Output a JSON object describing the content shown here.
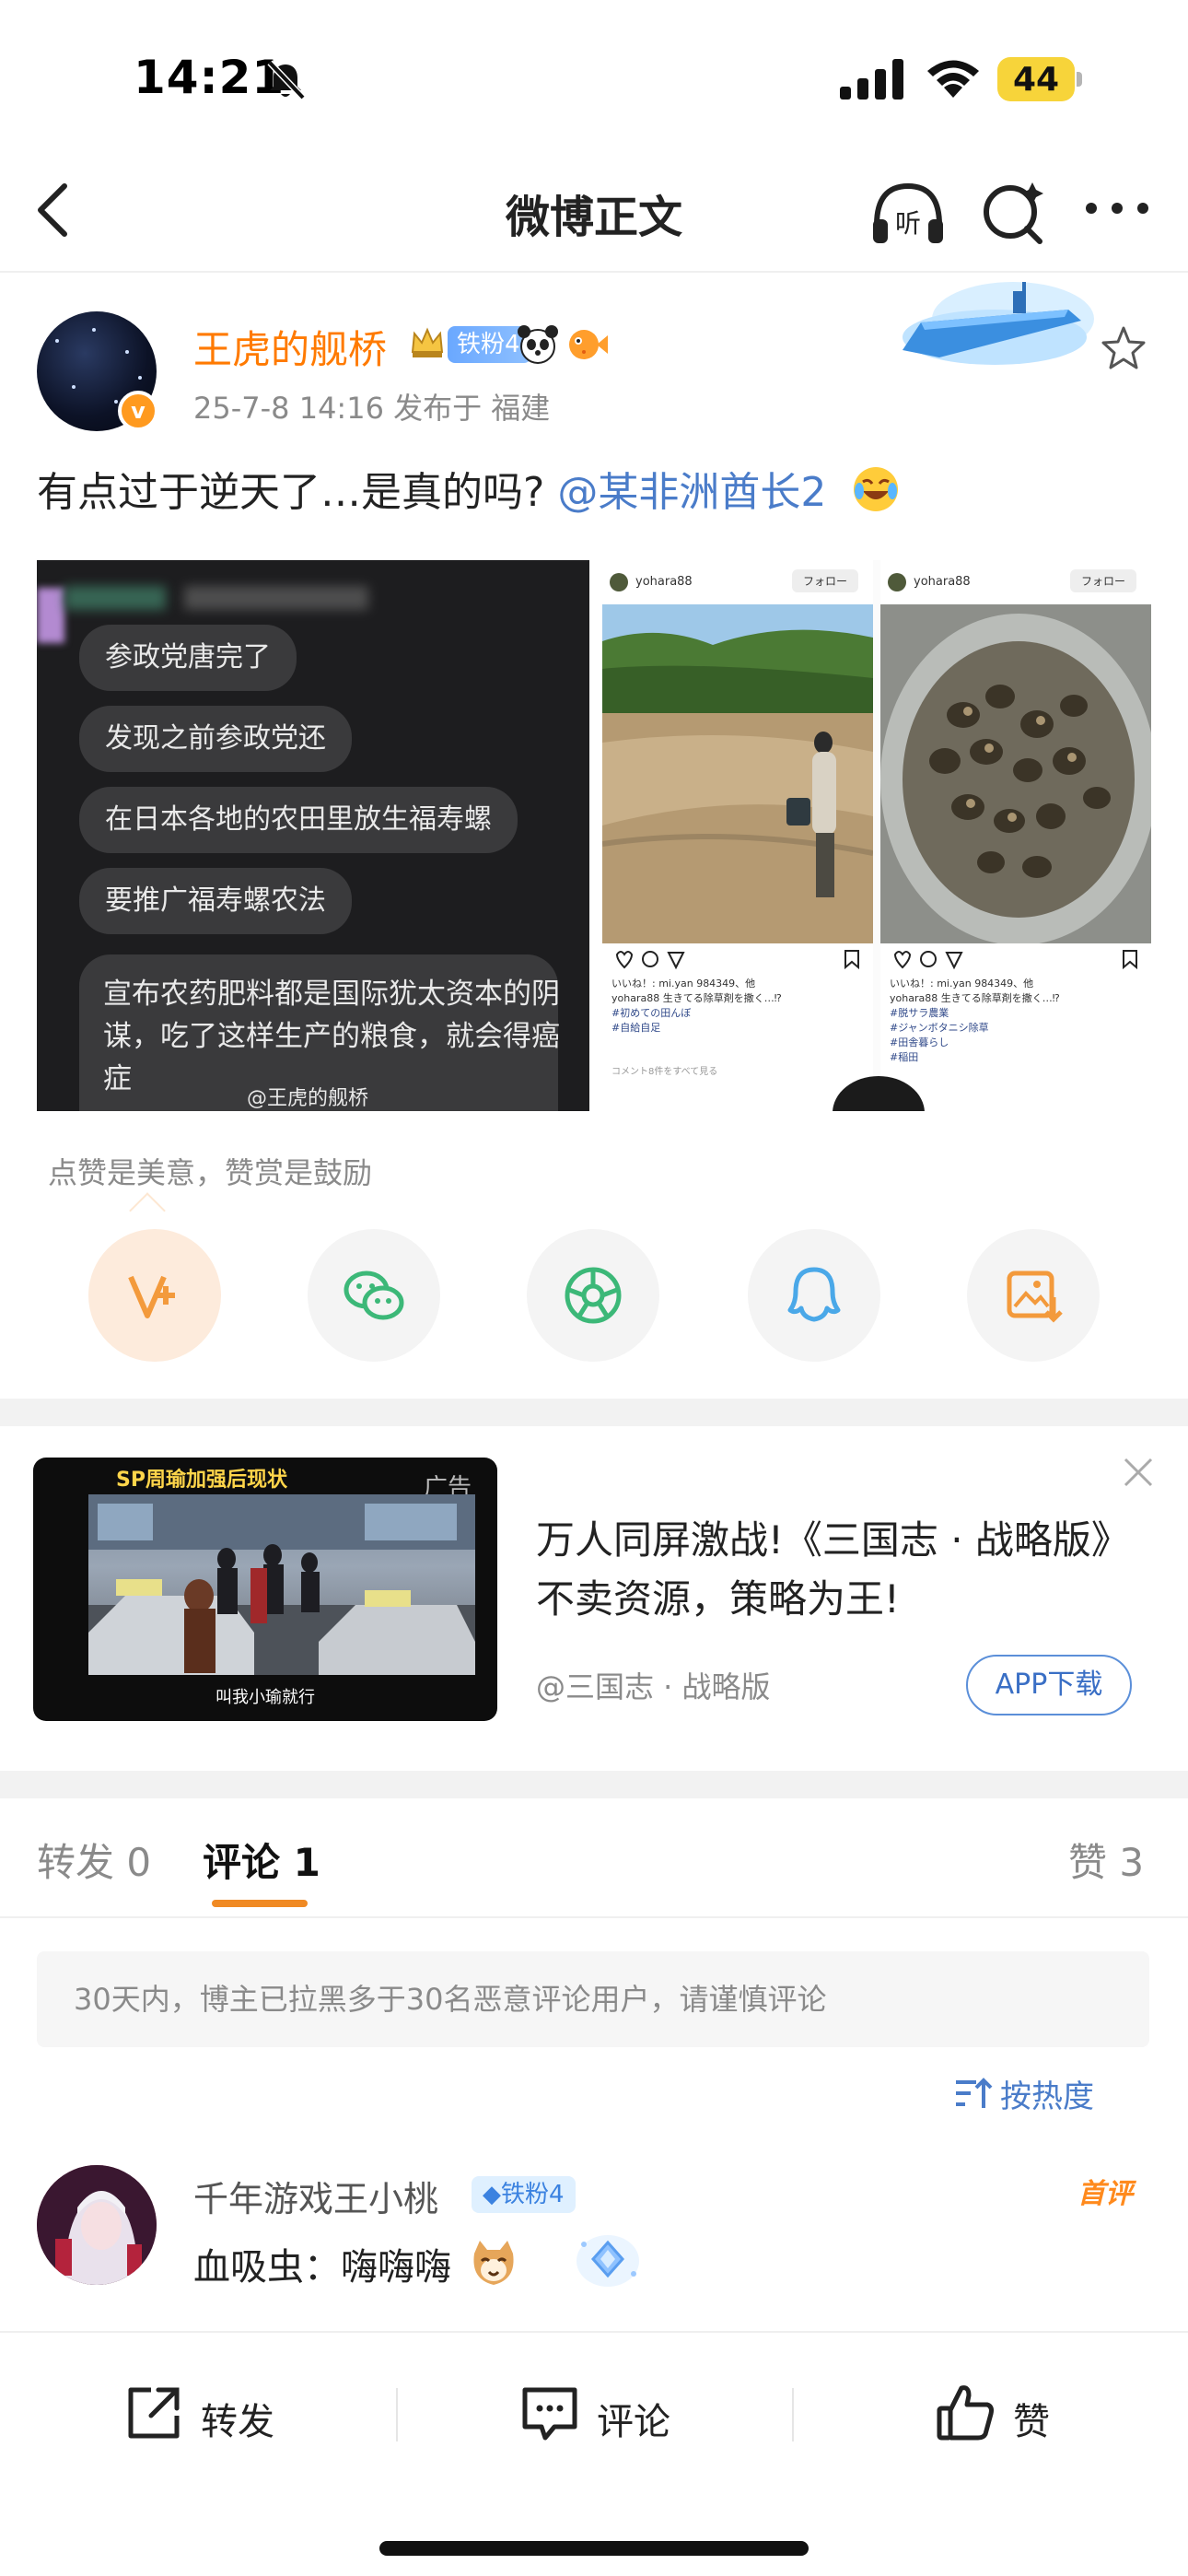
{
  "status": {
    "time": "14:21",
    "battery": "44"
  },
  "nav": {
    "title": "微博正文"
  },
  "post": {
    "author": "王虎的舰桥",
    "fan_badge": "铁粉4",
    "meta": "25-7-8 14:16  发布于 福建",
    "text_before": "有点过于逆天了…是真的吗?",
    "mention": "@某非洲酋长2",
    "watermark": "@王虎的舰桥"
  },
  "image1": {
    "chips": [
      "参政党唐完了",
      "发现之前参政党还",
      "在日本各地的农田里放生福寿螺",
      "要推广福寿螺农法"
    ],
    "big_text": "宣布农药肥料都是国际犹太资本的阴谋，吃了这样生产的粮食，就会得癌症"
  },
  "image2": {
    "user": "yohara88",
    "follow": "フォロー",
    "likes_left": "いいね！: mi.yan 984349、他",
    "likes_right": "いいね！: mi.yan 984349、他",
    "caption_left": "yohara88 生きてる除草剤を撒く…⁉",
    "caption_right": "yohara88 生きてる除草剤を撒く…⁉",
    "tags": [
      "#初めての田んぼ",
      "#自給自足",
      "#脱サラ農業",
      "#ジャンボタニシ除草",
      "#田舎暮らし",
      "#稲田"
    ],
    "see_all": "コメント8件をすべて見る"
  },
  "tip": "点赞是美意，赞赏是鼓励",
  "share_icons": [
    "v-plus-icon",
    "wechat-icon",
    "moments-icon",
    "qq-icon",
    "save-image-icon"
  ],
  "ad": {
    "image_caption_top": "SP周瑜加强后现状",
    "label": "广告",
    "image_caption_bottom": "叫我小瑜就行",
    "title": "万人同屏激战!《三国志 · 战略版》不卖资源，策略为王!",
    "source": "@三国志 · 战略版",
    "button": "APP下载"
  },
  "tabs": {
    "repost": {
      "label": "转发",
      "count": "0"
    },
    "comment": {
      "label": "评论",
      "count": "1"
    },
    "like": {
      "label": "赞",
      "count": "3"
    }
  },
  "notice": "30天内，博主已拉黑多于30名恶意评论用户，请谨慎评论",
  "sort_label": "按热度",
  "comment": {
    "user": "千年游戏王小桃",
    "badge": "铁粉4",
    "text": "血吸虫：嗨嗨嗨",
    "first_badge": "首评"
  },
  "bottom": {
    "repost": "转发",
    "comment": "评论",
    "like": "赞"
  },
  "colors": {
    "accent": "#ff7a00",
    "link": "#4a7cc9",
    "tab_underline": "#f08a24"
  }
}
